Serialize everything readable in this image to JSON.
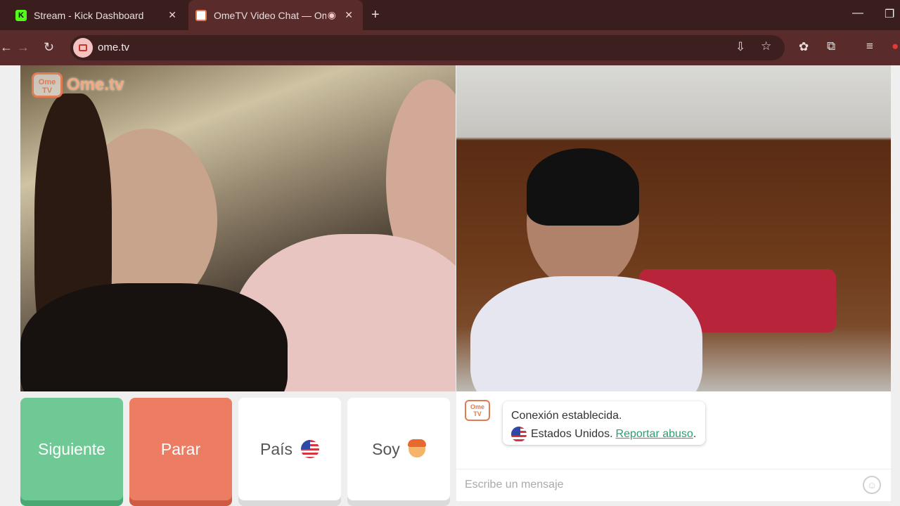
{
  "browser": {
    "tabs": [
      {
        "title": "Stream - Kick Dashboard",
        "favicon": "kick-icon"
      },
      {
        "title": "OmeTV Video Chat — Ome",
        "favicon": "ometv-icon"
      }
    ],
    "url": "ome.tv"
  },
  "logo": {
    "badge": "Ome\nTV",
    "text": "Ome.tv"
  },
  "buttons": {
    "next": "Siguiente",
    "stop": "Parar",
    "country": "País",
    "gender": "Soy"
  },
  "chat": {
    "logo_badge": "Ome\nTV",
    "connection": "Conexión establecida.",
    "country": "Estados Unidos.",
    "report": "Reportar abuso",
    "report_suffix": ".",
    "input_placeholder": "Escribe un mensaje"
  },
  "colors": {
    "next": "#6ec995",
    "stop": "#ec7c62",
    "report_link": "#2e9e6e",
    "brand": "#e07b52"
  }
}
